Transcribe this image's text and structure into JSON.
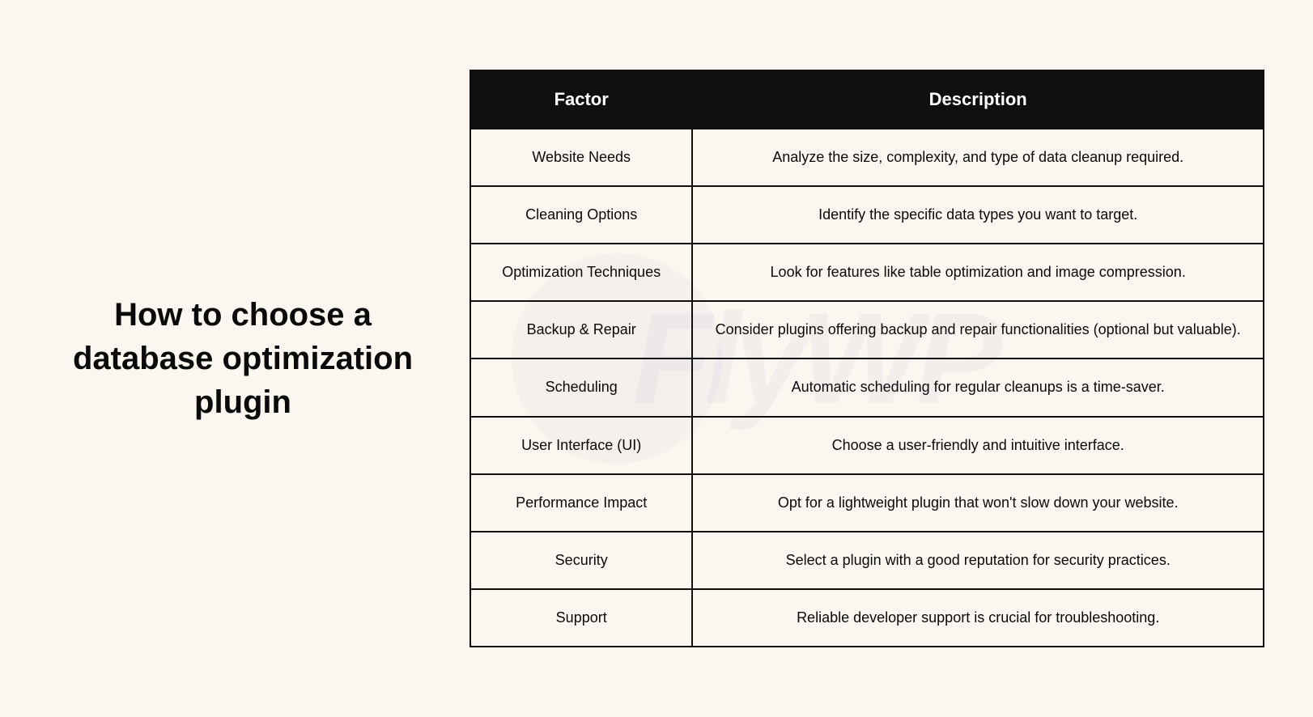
{
  "title": "How to choose a database optimization plugin",
  "watermark": "FlyWP",
  "table": {
    "headers": {
      "factor": "Factor",
      "description": "Description"
    },
    "rows": [
      {
        "factor": "Website Needs",
        "description": "Analyze the size, complexity, and type of data cleanup required."
      },
      {
        "factor": "Cleaning Options",
        "description": "Identify the specific data types you want to target."
      },
      {
        "factor": "Optimization Techniques",
        "description": "Look for features like table optimization and image compression."
      },
      {
        "factor": "Backup & Repair",
        "description": "Consider plugins offering backup and repair functionalities (optional but valuable)."
      },
      {
        "factor": "Scheduling",
        "description": "Automatic scheduling for regular cleanups is a time-saver."
      },
      {
        "factor": "User Interface (UI)",
        "description": "Choose a user-friendly and intuitive interface."
      },
      {
        "factor": "Performance Impact",
        "description": "Opt for a lightweight plugin that won't slow down your website."
      },
      {
        "factor": "Security",
        "description": "Select a plugin with a good reputation for security practices."
      },
      {
        "factor": "Support",
        "description": "Reliable developer support is crucial for troubleshooting."
      }
    ]
  }
}
